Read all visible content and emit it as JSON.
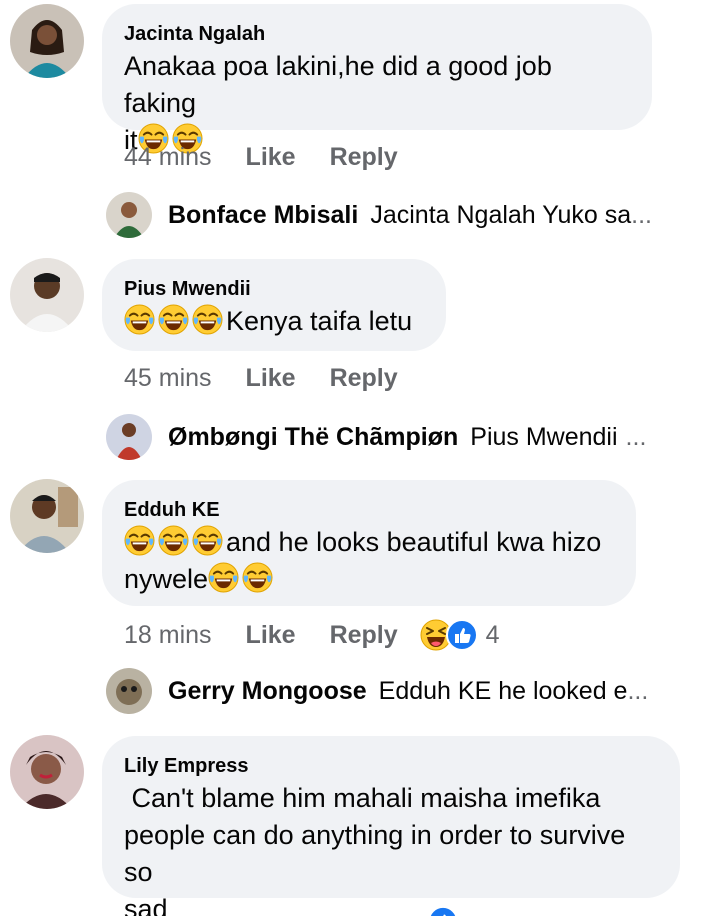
{
  "comments": [
    {
      "name": "Jacinta Ngalah",
      "text_line1": "Anakaa poa lakini,he did a good job faking",
      "text_line2_prefix": "it",
      "time": "44 mins",
      "like": "Like",
      "reply": "Reply",
      "reply_preview": {
        "name": "Bonface Mbisali",
        "text": "Jacinta Ngalah Yuko sa",
        "ellipsis": "..."
      }
    },
    {
      "name": "Pius Mwendii",
      "text": "Kenya taifa letu",
      "time": "45 mins",
      "like": "Like",
      "reply": "Reply",
      "reply_preview": {
        "name": "Ømbøngi Thë Chãmpiøn",
        "text": "Pius Mwendii",
        "ellipsis": "..."
      }
    },
    {
      "name": "Edduh KE",
      "text_line1": "and he looks beautiful kwa hizo",
      "text_line2_prefix": "nywele",
      "time": "18 mins",
      "like": "Like",
      "reply": "Reply",
      "reaction_count": "4",
      "reply_preview": {
        "name": "Gerry Mongoose",
        "text": "Edduh KE  he looked e",
        "ellipsis": "..."
      }
    },
    {
      "name": "Lily Empress",
      "text_line1": " Can't blame him mahali maisha imefika",
      "text_line2": "people can do anything in order to survive so",
      "text_line3": "sad"
    }
  ],
  "icons": {
    "emoji": "face-with-tears-of-joy-icon",
    "reactions": [
      "haha-reaction-icon",
      "like-reaction-icon"
    ]
  },
  "colors": {
    "bubble_bg": "#f0f2f5",
    "meta_text": "#65676b",
    "like_blue": "#1877f2",
    "emoji_yellow": "#ffcc33"
  }
}
